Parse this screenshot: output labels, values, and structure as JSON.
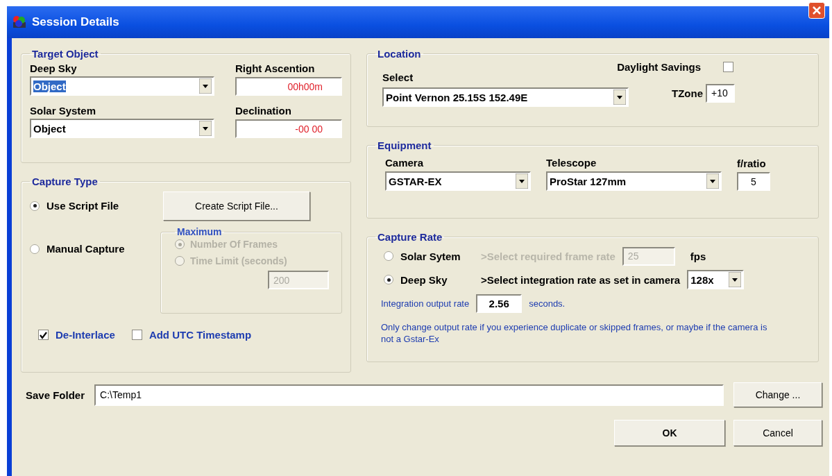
{
  "window": {
    "title": "Session Details"
  },
  "target_object": {
    "title": "Target Object",
    "deep_sky": {
      "label": "Deep Sky",
      "value": "Object",
      "highlighted": true
    },
    "right_ascension": {
      "label": "Right Ascention",
      "value": "00h00m"
    },
    "solar_system": {
      "label": "Solar System",
      "value": "Object",
      "highlighted": false
    },
    "declination": {
      "label": "Declination",
      "value": "-00 00"
    }
  },
  "capture_type": {
    "title": "Capture Type",
    "options": [
      {
        "label": "Use Script File",
        "selected": true
      },
      {
        "label": "Manual Capture",
        "selected": false
      }
    ],
    "create_button": "Create Script File...",
    "maximum": {
      "title": "Maximum",
      "disabled": true,
      "options": [
        {
          "label": "Number Of Frames",
          "selected": true
        },
        {
          "label": "Time Limit (seconds)",
          "selected": false
        }
      ],
      "value": "200"
    },
    "checkboxes": [
      {
        "label": "De-Interlace",
        "checked": true
      },
      {
        "label": "Add UTC Timestamp",
        "checked": false
      }
    ]
  },
  "location": {
    "title": "Location",
    "daylight_label": "Daylight Savings",
    "daylight_checked": false,
    "select_label": "Select",
    "select_value": "Point Vernon 25.15S 152.49E",
    "tzone_label": "TZone",
    "tzone_value": "+10"
  },
  "equipment": {
    "title": "Equipment",
    "fields": [
      {
        "kind": "dropdown",
        "label": "Camera",
        "value": "GSTAR-EX"
      },
      {
        "kind": "dropdown",
        "label": "Telescope",
        "value": "ProStar 127mm"
      },
      {
        "kind": "input",
        "label": "f/ratio",
        "value": "5"
      }
    ]
  },
  "capture_rate": {
    "title": "Capture Rate",
    "options": [
      {
        "label": "Solar Sytem",
        "selected": false,
        "hint": ">Select required frame rate",
        "disabled": true,
        "kind": "input",
        "value": "25",
        "unit": "fps"
      },
      {
        "label": "Deep Sky",
        "selected": true,
        "hint": ">Select integration rate as set in camera",
        "disabled": false,
        "kind": "dropdown",
        "value": "128x"
      }
    ],
    "output_label": "Integration output rate",
    "output_value": "2.56",
    "output_unit": "seconds.",
    "note": "Only change output rate if you experience duplicate or skipped frames, or maybe if the camera is not a Gstar-Ex"
  },
  "save_folder": {
    "label": "Save Folder",
    "value": "C:\\Temp1",
    "button": "Change ..."
  },
  "buttons": [
    "OK",
    "Cancel"
  ]
}
